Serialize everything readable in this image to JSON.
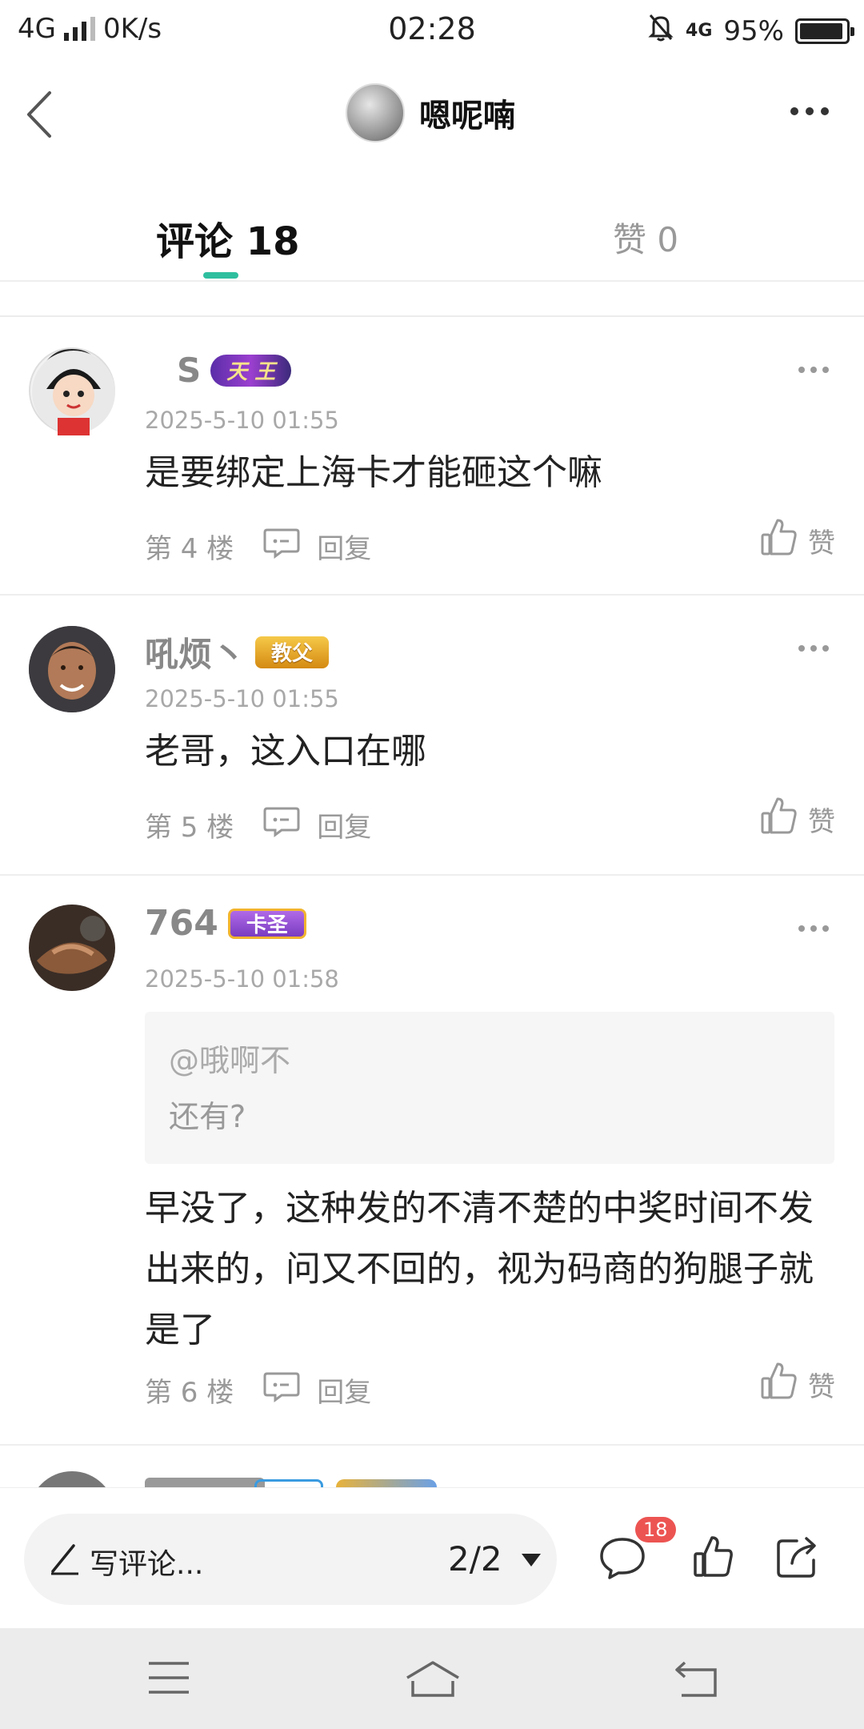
{
  "status_bar": {
    "network": "4G",
    "speed": "0K/s",
    "time": "02:28",
    "mobile_data": "4G",
    "battery_percent": "95%",
    "battery_level": 0.95
  },
  "header": {
    "title": "嗯呢喃"
  },
  "tabs": {
    "comments_label": "评论 18",
    "likes_label": "赞 0"
  },
  "comments": [
    {
      "username": "S",
      "badge": "天 王",
      "time": "2025-5-10 01:55",
      "content": "是要绑定上海卡才能砸这个嘛",
      "floor": "第 4 楼",
      "reply": "回复",
      "like": "赞"
    },
    {
      "username": "吼烦丶",
      "badge": "教父",
      "time": "2025-5-10 01:55",
      "content": "老哥，这入口在哪",
      "floor": "第 5 楼",
      "reply": "回复",
      "like": "赞"
    },
    {
      "username": "764",
      "badge": "卡圣",
      "time": "2025-5-10 01:58",
      "quote_user": "@哦啊不",
      "quote_text": "还有?",
      "content": "早没了，这种发的不清不楚的中奖时间不发出来的，问又不回的，视为码商的狗腿子就是了",
      "floor": "第 6 楼",
      "reply": "回复",
      "like": "赞"
    }
  ],
  "bottom_bar": {
    "write_placeholder": "写评论...",
    "page_indicator": "2/2",
    "comment_count": "18"
  },
  "colors": {
    "accent": "#2ebf9f",
    "badge_red": "#ec5452"
  }
}
